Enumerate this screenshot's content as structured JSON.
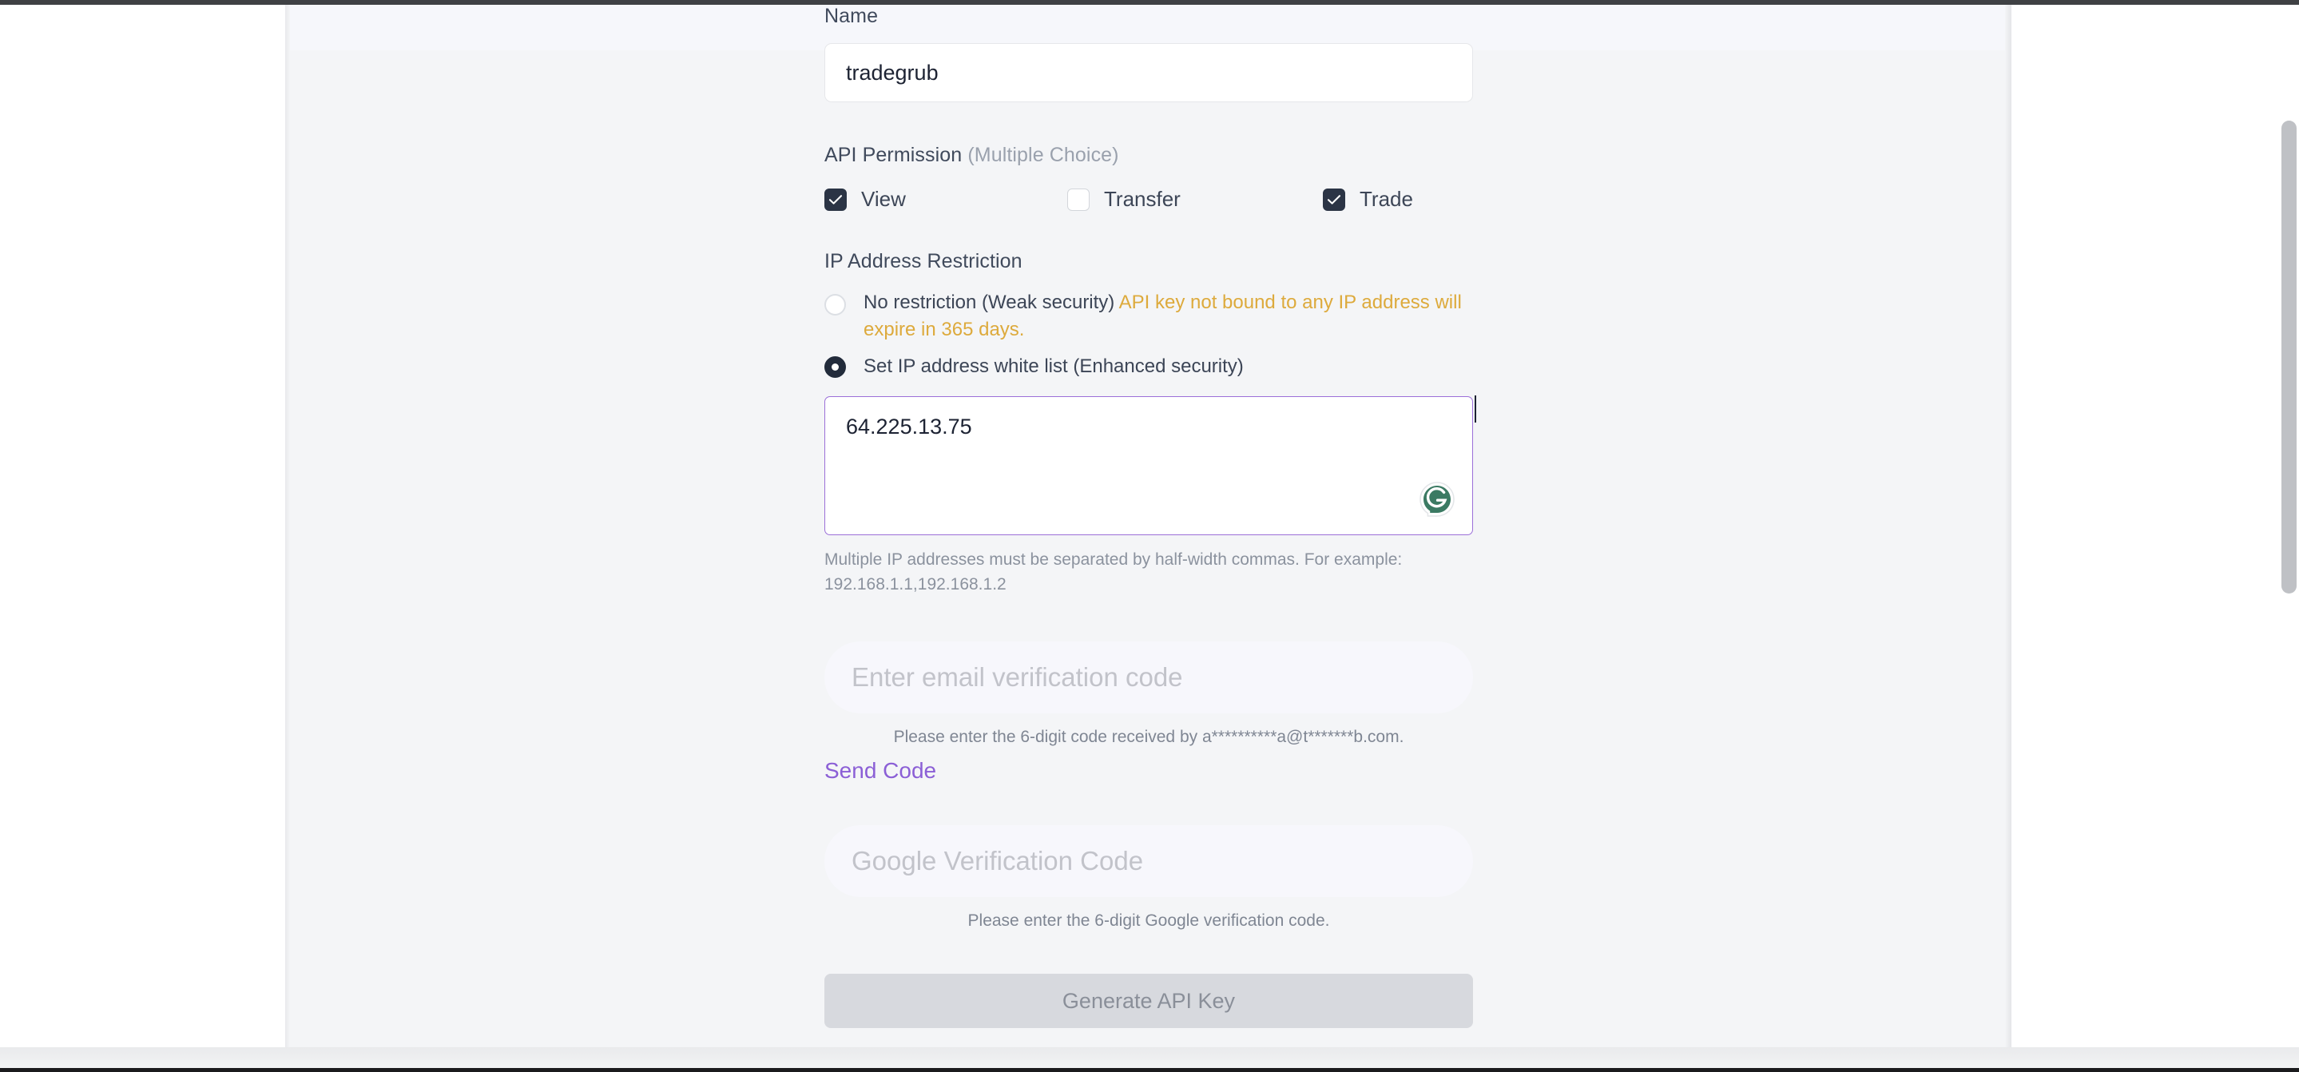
{
  "form": {
    "name": {
      "label": "Name",
      "value": "tradegrub"
    },
    "api_permission": {
      "label": "API Permission",
      "hint": "(Multiple Choice)",
      "options": [
        {
          "label": "View",
          "checked": true,
          "icon": "checkbox-checked-icon"
        },
        {
          "label": "Transfer",
          "checked": false,
          "icon": "checkbox-unchecked-icon"
        },
        {
          "label": "Trade",
          "checked": true,
          "icon": "checkbox-checked-icon"
        }
      ]
    },
    "ip_restriction": {
      "label": "IP Address Restriction",
      "options": [
        {
          "label": "No restriction (Weak security)",
          "warning": "API key not bound to any IP address will expire in 365 days.",
          "selected": false
        },
        {
          "label": "Set IP address white list (Enhanced security)",
          "selected": true
        }
      ],
      "textarea_value": "64.225.13.75",
      "helper": "Multiple IP addresses must be separated by half-width commas. For example: 192.168.1.1,192.168.1.2",
      "grammarly_icon": "grammarly-badge-icon"
    },
    "email_code": {
      "placeholder": "Enter email verification code",
      "value": "",
      "note": "Please enter the 6-digit code received by a**********a@t*******b.com.",
      "send_code_label": "Send Code"
    },
    "google_code": {
      "placeholder": "Google Verification Code",
      "value": "",
      "note": "Please enter the 6-digit Google verification code."
    },
    "submit": {
      "label": "Generate API Key",
      "disabled": true
    }
  },
  "colors": {
    "accent_purple": "#8b5fd6",
    "warning_amber": "#ddaa3c",
    "checkbox_dark": "#2b3445",
    "grammarly_green": "#3b7a63",
    "disabled_btn": "#d7d9de"
  }
}
